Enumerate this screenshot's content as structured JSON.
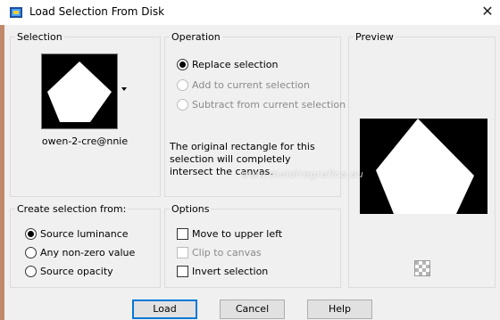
{
  "window": {
    "title": "Load Selection From Disk",
    "close_glyph": "✕"
  },
  "selection": {
    "label": "Selection",
    "file_name": "owen-2-cre@nnie"
  },
  "operation": {
    "label": "Operation",
    "options": [
      {
        "label": "Replace selection",
        "selected": true,
        "enabled": true
      },
      {
        "label": "Add to current selection",
        "selected": false,
        "enabled": false
      },
      {
        "label": "Subtract from current selection",
        "selected": false,
        "enabled": false
      }
    ],
    "info_text": "The original rectangle for this selection will completely intersect the canvas."
  },
  "preview": {
    "label": "Preview",
    "icon": "checker-icon"
  },
  "create_from": {
    "label": "Create selection from:",
    "options": [
      {
        "label": "Source luminance",
        "selected": true
      },
      {
        "label": "Any non-zero value",
        "selected": false
      },
      {
        "label": "Source opacity",
        "selected": false
      }
    ]
  },
  "options": {
    "label": "Options",
    "items": [
      {
        "label": "Move to upper left",
        "checked": false,
        "enabled": true
      },
      {
        "label": "Clip to canvas",
        "checked": false,
        "enabled": false
      },
      {
        "label": "Invert selection",
        "checked": false,
        "enabled": true
      }
    ]
  },
  "buttons": {
    "load": "Load",
    "cancel": "Cancel",
    "help": "Help"
  },
  "watermark": "www.maldiregrafica.eu",
  "colors": {
    "default_button_border": "#0078d7",
    "dialog_bg": "#f0f0f0"
  }
}
